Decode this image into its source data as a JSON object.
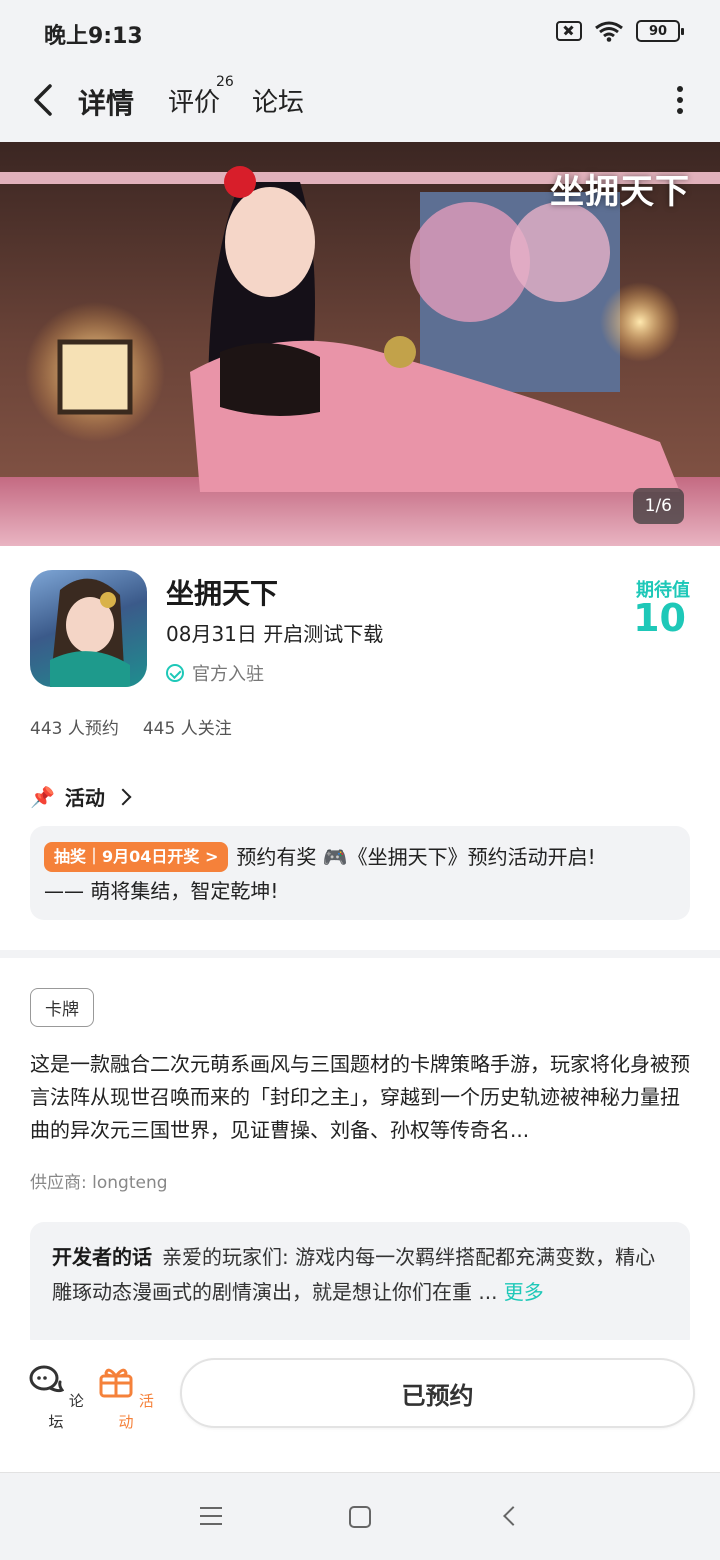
{
  "status_bar": {
    "time": "晚上9:13",
    "battery": "90",
    "icons": [
      "sim-missing-icon",
      "wifi-icon",
      "battery-icon"
    ]
  },
  "nav": {
    "tabs": [
      {
        "label": "详情",
        "active": true
      },
      {
        "label": "评价",
        "badge": "26"
      },
      {
        "label": "论坛"
      }
    ],
    "icons": [
      "back-arrow-icon",
      "more-vertical-icon"
    ]
  },
  "banner": {
    "logo_text": "坐拥天下",
    "counter": "1/6"
  },
  "game": {
    "title": "坐拥天下",
    "release_text": "08月31日 开启测试下载",
    "official_text": "官方入驻",
    "expect_label": "期待值",
    "expect_value": "10",
    "reservations": "443 人预约",
    "follows": "445 人关注"
  },
  "activity": {
    "heading": "活动",
    "tag": "抽奖｜9月04日开奖 >",
    "text_line1": "预约有奖 🎮《坐拥天下》预约活动开启!",
    "text_line2": "—— 萌将集结，智定乾坤!"
  },
  "description": {
    "genre": "卡牌",
    "text": "这是一款融合二次元萌系画风与三国题材的卡牌策略手游，玩家将化身被预言法阵从现世召唤而来的「封印之主」，穿越到一个历史轨迹被神秘力量扭曲的异次元三国世界，见证曹操、刘备、孙权等传奇名...",
    "supplier": "供应商: longteng"
  },
  "developer_note": {
    "label": "开发者的话",
    "text": "亲爱的玩家们: 游戏内每一次羁绊搭配都充满变数，精心雕琢动态漫画式的剧情演出，就是想让你们在重 ...",
    "more": "更多"
  },
  "bottom_bar": {
    "forum_label": "论坛",
    "activity_label": "活动",
    "reserve_button": "已预约"
  },
  "colors": {
    "accent": "#1ec8b8",
    "orange": "#f5813a",
    "background": "#f2f3f5"
  }
}
